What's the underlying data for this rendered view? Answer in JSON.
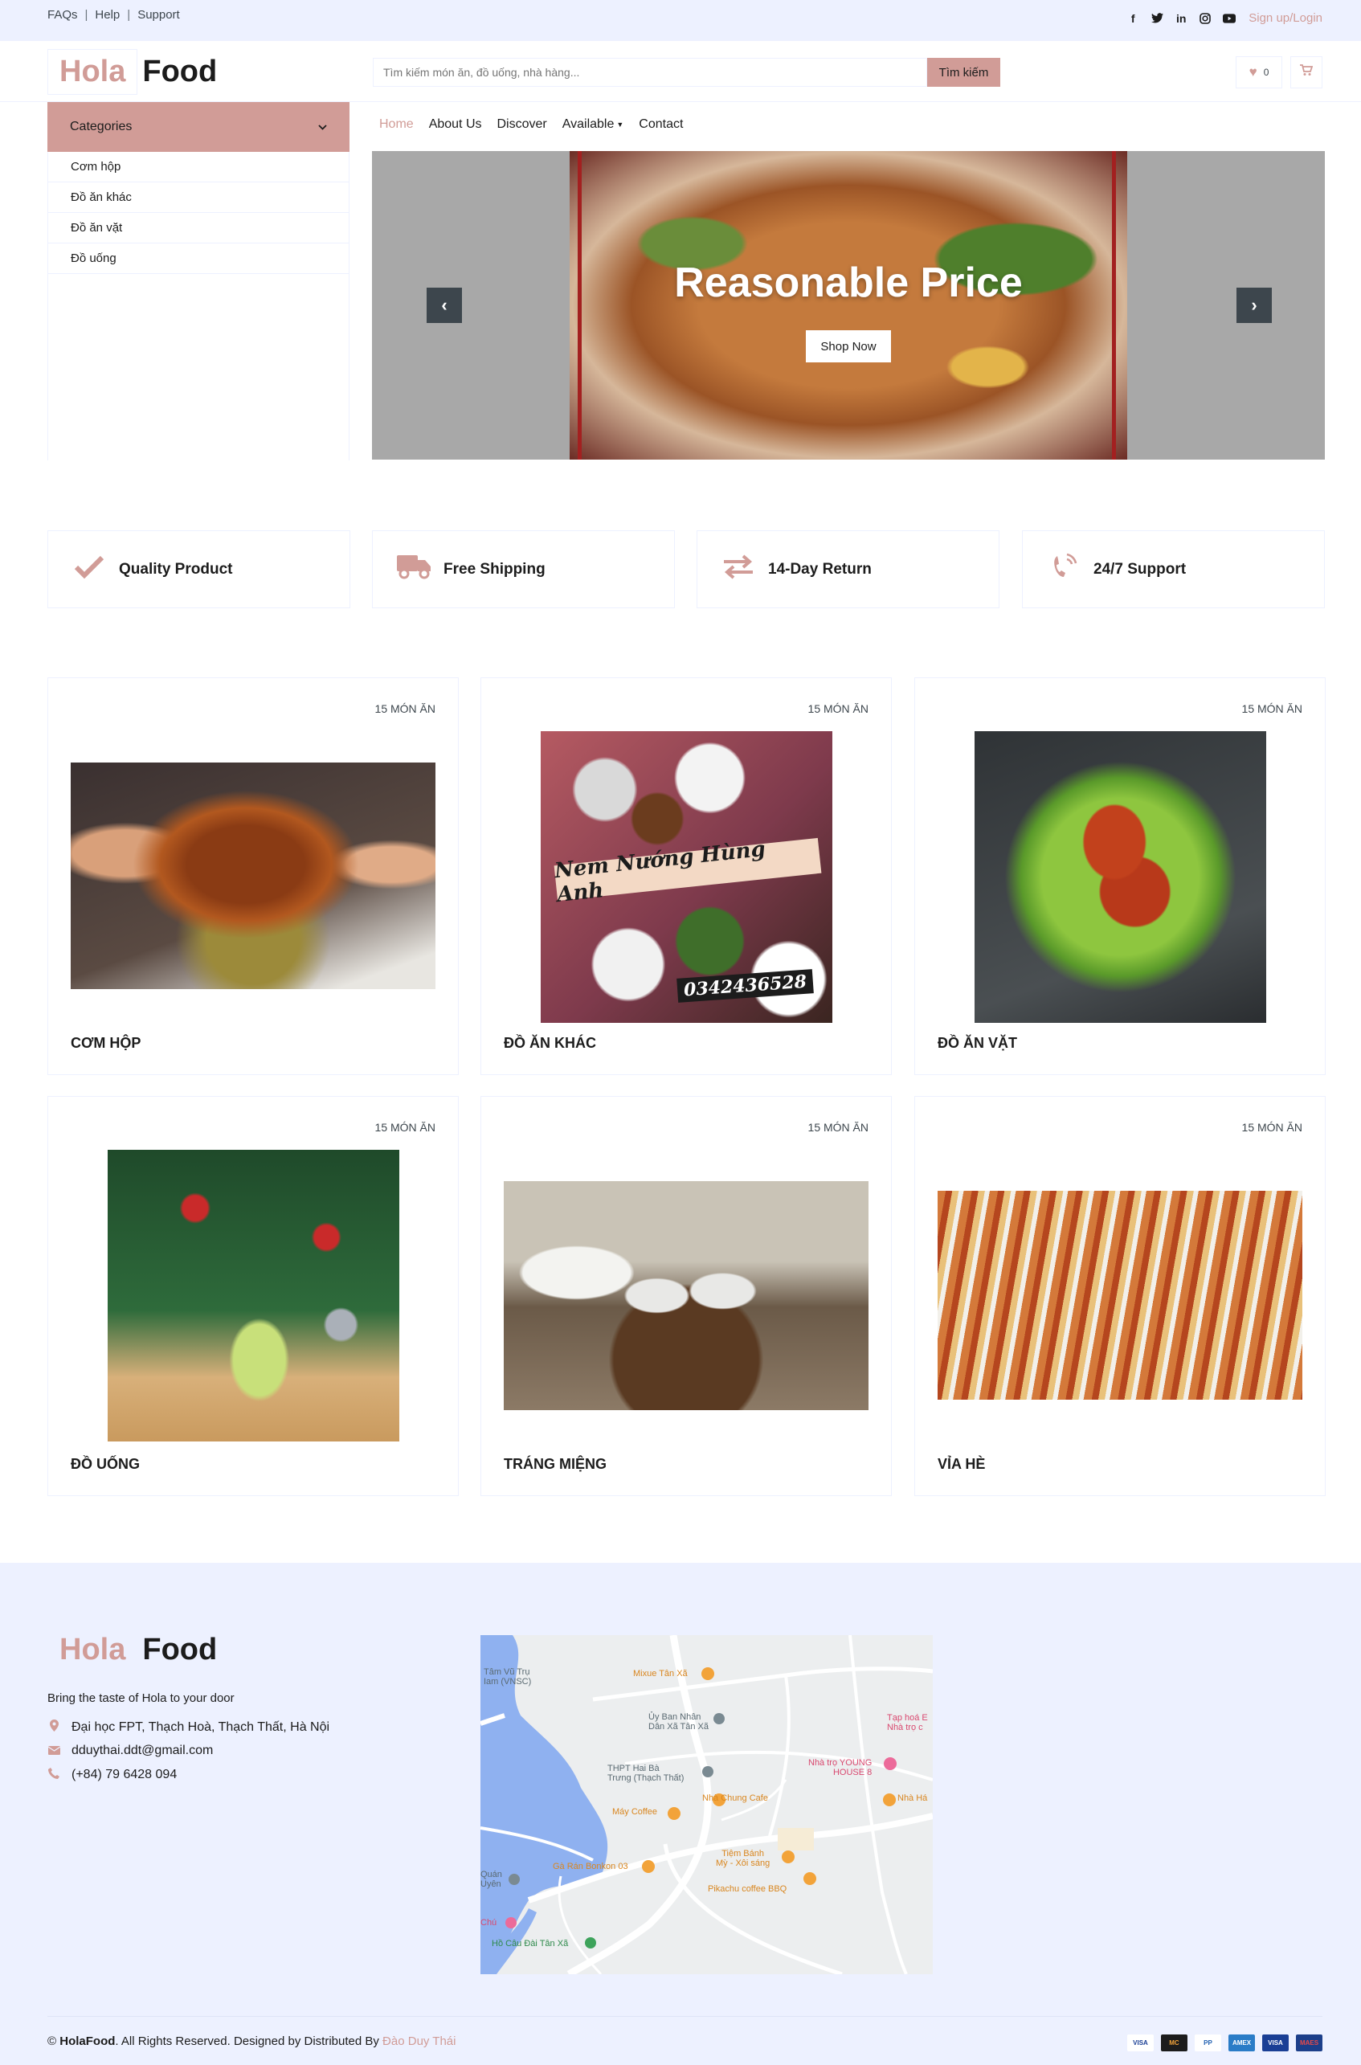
{
  "topbar": {
    "links": [
      "FAQs",
      "Help",
      "Support"
    ],
    "login": "Sign up/Login"
  },
  "brand": {
    "part1": "Hola",
    "part2": "Food"
  },
  "search": {
    "placeholder": "Tìm kiếm món ăn, đồ uống, nhà hàng...",
    "button": "Tìm kiếm"
  },
  "header": {
    "wishlist_count": "0"
  },
  "categories": {
    "title": "Categories",
    "items": [
      "Cơm hộp",
      "Đồ ăn khác",
      "Đồ ăn vặt",
      "Đồ uống"
    ]
  },
  "nav": {
    "items": [
      "Home",
      "About Us",
      "Discover",
      "Available",
      "Contact"
    ]
  },
  "carousel": {
    "title": "Reasonable Price",
    "button": "Shop Now"
  },
  "features": [
    "Quality Product",
    "Free Shipping",
    "14-Day Return",
    "24/7 Support"
  ],
  "cards": [
    {
      "count": "15 MÓN ĂN",
      "name": "CƠM HỘP"
    },
    {
      "count": "15 MÓN ĂN",
      "name": "ĐỒ ĂN KHÁC",
      "image_caption": "Nem Nướng Hùng Anh",
      "image_phone": "0342436528"
    },
    {
      "count": "15 MÓN ĂN",
      "name": "ĐỒ ĂN VẶT"
    },
    {
      "count": "15 MÓN ĂN",
      "name": "ĐỒ UỐNG"
    },
    {
      "count": "15 MÓN ĂN",
      "name": "TRÁNG MIỆNG"
    },
    {
      "count": "15 MÓN ĂN",
      "name": "VỈA HÈ"
    }
  ],
  "footer": {
    "description": "Bring the taste of Hola to your door",
    "address": "Đại học FPT, Thạch Hoà, Thạch Thất, Hà Nội",
    "email": "dduythai.ddt@gmail.com",
    "phone": "(+84) 79 6428 094",
    "copyright_brand": "HolaFood",
    "copyright_text": ". All Rights Reserved. Designed by Distributed By",
    "author": "Đào Duy Thái",
    "payments": [
      "VISA",
      "MC",
      "PP",
      "AMEX",
      "VISA",
      "MAES"
    ]
  },
  "map": {
    "labels": [
      "Tâm Vũ Trụ",
      "Iam (VNSC)",
      "Mixue Tân Xã",
      "Ủy Ban Nhân",
      "Dân Xã Tân Xã",
      "Tạp hoá E",
      "Nhà trọ c",
      "THPT Hai Bà",
      "Trưng (Thạch Thất)",
      "Nhà trọ YOUNG",
      "HOUSE 8",
      "Nhà Chung Cafe",
      "Nhà Há",
      "Máy Coffee",
      "Tiệm Bánh",
      "Mỳ - Xôi sáng",
      "Quán",
      "Uyên",
      "Gà Rán Bonkon 03",
      "Pikachu coffee BBQ",
      "Chú",
      "Hồ Câu Đài Tân Xã"
    ]
  },
  "colors": {
    "accent": "#d19c97",
    "light_bg": "#edf1ff",
    "dark": "#1c1c1c"
  }
}
